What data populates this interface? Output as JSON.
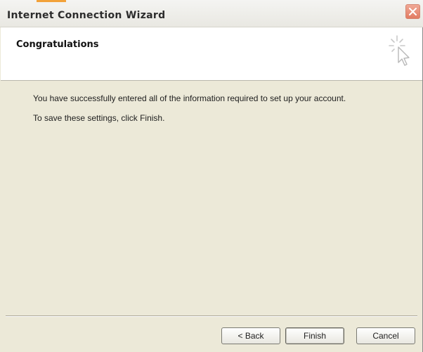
{
  "window": {
    "title": "Internet Connection Wizard"
  },
  "header": {
    "heading": "Congratulations"
  },
  "content": {
    "line1": "You have successfully entered all of the information required to set up your account.",
    "line2": "To save these settings, click Finish."
  },
  "buttons": {
    "back": "< Back",
    "finish": "Finish",
    "cancel": "Cancel"
  },
  "icons": {
    "close": "close-icon",
    "wizard": "wizard-cursor-icon"
  },
  "colors": {
    "dialog_bg": "#ece9d8",
    "close_button": "#e27b62"
  }
}
